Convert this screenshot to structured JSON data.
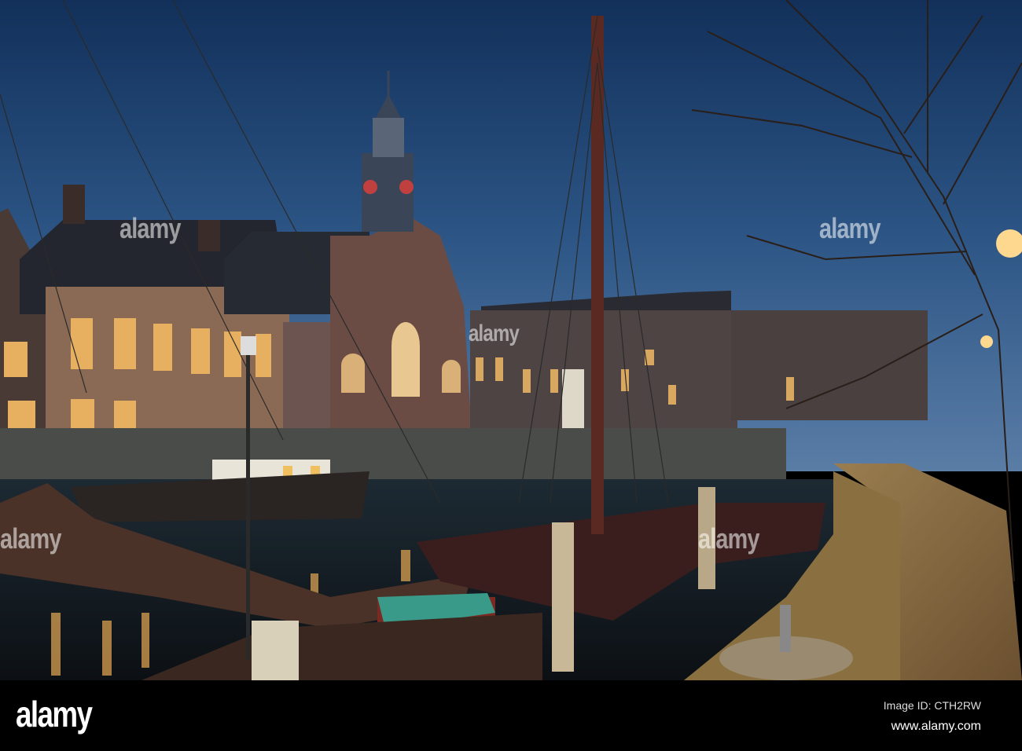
{
  "watermark": "alamy",
  "footer": {
    "logo": "alamy",
    "image_id": "Image ID: CTH2RW",
    "url": "www.alamy.com"
  }
}
